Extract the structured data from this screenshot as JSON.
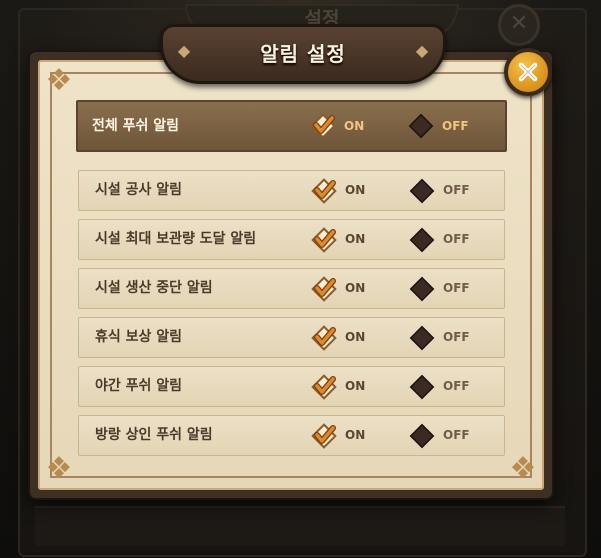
{
  "background": {
    "title": "설정",
    "close_glyph": "✕"
  },
  "dialog": {
    "title": "알림 설정",
    "close_icon": "close-x-icon"
  },
  "toggle_labels": {
    "on": "ON",
    "off": "OFF"
  },
  "master": {
    "label": "전체 푸쉬 알림",
    "state": "on"
  },
  "rows": [
    {
      "label": "시설 공사 알림",
      "state": "on"
    },
    {
      "label": "시설 최대 보관량 도달 알림",
      "state": "on"
    },
    {
      "label": "시설 생산 중단 알림",
      "state": "on"
    },
    {
      "label": "휴식 보상 알림",
      "state": "on"
    },
    {
      "label": "야간 푸쉬 알림",
      "state": "on"
    },
    {
      "label": "방랑 상인 푸쉬 알림",
      "state": "on"
    }
  ],
  "colors": {
    "check_orange": "#e0892a",
    "diamond_dark": "#3a2a22",
    "panel_cream": "#efe3c8",
    "master_row": "#7d6346",
    "close_gold": "#f2b53a"
  }
}
